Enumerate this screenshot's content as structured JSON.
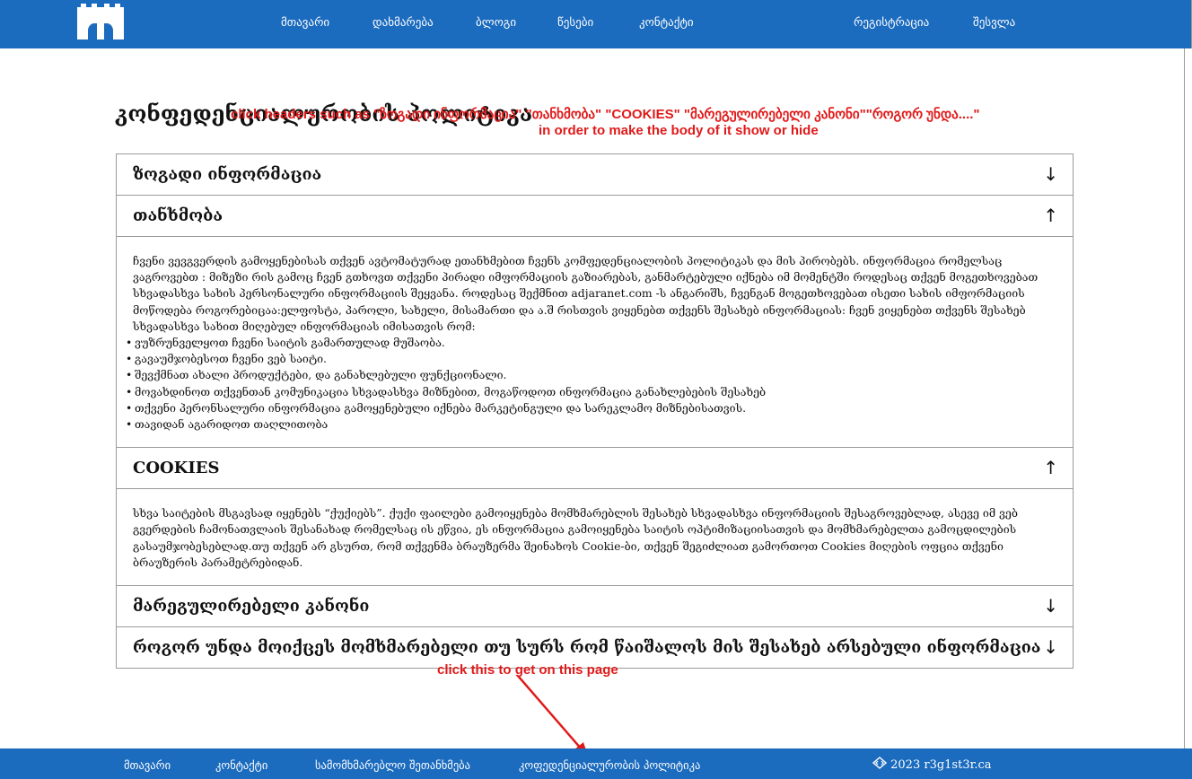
{
  "nav": {
    "links": [
      "მთავარი",
      "დახმარება",
      "ბლოგი",
      "წესები",
      "კონტაქტი"
    ],
    "register": "რეგისტრაცია",
    "login": "შესვლა"
  },
  "page": {
    "title": "კონფედენციალურობის პოლიტიკა"
  },
  "annotations": {
    "top_line1": "click headers such as \"ზოგადი ინფორმაცია\" \"თანხმობა\" \"COOKIES\" \"მარეგულირებელი კანონი\"\"როგორ უნდა....\"",
    "top_line2": "in order to make the body of it show or hide",
    "bottom": "click this to get on this page",
    "color": "#e01a1a"
  },
  "accordion": {
    "general": {
      "title": "ზოგადი ინფორმაცია",
      "arrow": "↓"
    },
    "consent": {
      "title": "თანხმობა",
      "arrow": "↑",
      "body": "ჩვენი ვევგვერდის გამოყენებისას თქვენ ავტომატურად ეთანხმებით ჩვენს კომფედენციალობის პოლიტიკას და მის პირობებს. ინფორმაცია რომელსაც ვაგროვებთ : მიზეზი რის გამოც ჩვენ გთხოვთ თქვენი პირადი იმფორმაციის გაზიარებას, განმარტებული იქნება იმ მომენტში როდესაც თქვენ მოგეთხოვებათ სხვადასხვა სახის პერსონალური ინფორმაციის შეყვანა. როდესაც შექმნით adjaranet.com -ს ანგარიშს, ჩვენგან მოგეთხოვებათ ისეთი სახის იმფორმაციის მოწოდება როგორებიცაა:ელფოსტა, პაროლი, სახელი, მისამართი და ა.შ რისთვის ვიყენებთ თქვენს შესახებ ინფორმაციას: ჩვენ ვიყენებთ თქვენს შესახებ სხვადასხვა სახით მიღებულ ინფორმაციას იმისათვის რომ:",
      "items": [
        "ვუზრუნველყოთ ჩვენი საიტის გამართულად მუშაობა.",
        "გავაუმჯობესოთ ჩვენი ვებ საიტი.",
        "შევქმნათ ახალი პროდუქტები, და განახლებული ფუნქციონალი.",
        "მოვახდინოთ თქვენთან კომუნიკაცია სხვადასხვა მიზნებით, მოგაწოდოთ ინფორმაცია განახლებების შესახებ",
        "თქვენი პერონსალური ინფორმაცია გამოყენებული იქნება მარკეტინგული და სარეკლამო მიზნებისათვის.",
        "თავიდან აგარიდოთ თაღლითობა"
      ]
    },
    "cookies": {
      "title": "COOKIES",
      "arrow": "↑",
      "body": "სხვა საიტების მსგავსად იყენებს “ქუქიებს”. ქუქი ფაილები გამოიყენება მომხმარებლის შესახებ სხვადასხვა ინფორმაციის შესაგროვებლად, ასევე იმ ვებ გვერდების ჩამონათვლაის შესანახად რომელსაც ის ეწვია, ეს ინფორმაცია გამოიყენება საიტის ოპტიმიზაციისათვის და მომხმარებელთა გამოცდილების გასაუმჯობესებლად.თუ თქვენ არ გსურთ, რომ თქვენმა ბრაუზერმა შეინახოს Cookie-ბი, თქვენ შეგიძლიათ გამორთოთ Cookies მიღების ოფცია თქვენი ბრაუზერის პარამეტრებიდან."
    },
    "law": {
      "title": "მარეგულირებელი კანონი",
      "arrow": "↓"
    },
    "howto": {
      "title": "როგორ უნდა მოიქცეს მომხმარებელი თუ სურს რომ წაიშალოს მის შესახებ არსებული ინფორმაცია",
      "arrow": "↓"
    }
  },
  "footer": {
    "links": [
      "მთავარი",
      "კონტაქტი",
      "სამომხმარებლო შეთანხმება",
      "კოფედენციალურობის პოლიტიკა"
    ],
    "copyright": "2023 r3g1st3r.ca",
    "copyright_icon": "diamond-code-icon"
  },
  "colors": {
    "brand_blue": "#1b6bbe",
    "border": "#9a9a9a"
  }
}
